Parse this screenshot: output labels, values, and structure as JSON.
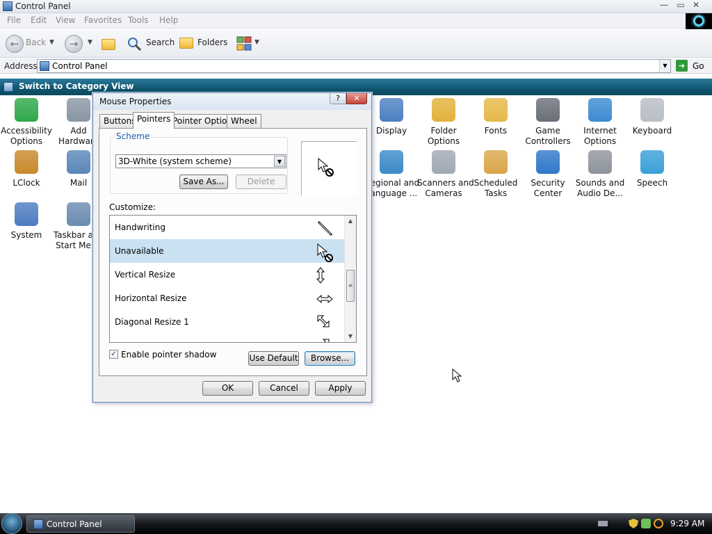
{
  "window": {
    "title": "Control Panel",
    "controls": {
      "minimize": "—",
      "maximize": "▭",
      "close": "✕"
    }
  },
  "menu": [
    "File",
    "Edit",
    "View",
    "Favorites",
    "Tools",
    "Help"
  ],
  "toolbar": {
    "back_label": "Back",
    "search_label": "Search",
    "folders_label": "Folders"
  },
  "address": {
    "label": "Address",
    "value": "Control Panel",
    "go_label": "Go"
  },
  "sidebar": {
    "task_label": "Switch to Category View"
  },
  "control_panel_items": [
    {
      "label": "Accessibility\nOptions",
      "icon": "accessibility-icon"
    },
    {
      "label": "Add\nHardware",
      "icon": "add-hardware-icon"
    },
    {
      "label": "Display",
      "icon": "display-icon"
    },
    {
      "label": "Folder\nOptions",
      "icon": "folder-options-icon"
    },
    {
      "label": "Fonts",
      "icon": "fonts-icon"
    },
    {
      "label": "Game\nControllers",
      "icon": "game-controllers-icon"
    },
    {
      "label": "Internet\nOptions",
      "icon": "internet-options-icon"
    },
    {
      "label": "Keyboard",
      "icon": "keyboard-icon"
    },
    {
      "label": "LClock",
      "icon": "lclock-icon"
    },
    {
      "label": "Mail",
      "icon": "mail-icon"
    },
    {
      "label": "Regional and\nLanguage ...",
      "icon": "regional-icon"
    },
    {
      "label": "Scanners and\nCameras",
      "icon": "scanners-icon"
    },
    {
      "label": "Scheduled\nTasks",
      "icon": "scheduled-tasks-icon"
    },
    {
      "label": "Security\nCenter",
      "icon": "security-center-icon"
    },
    {
      "label": "Sounds and\nAudio De...",
      "icon": "sounds-icon"
    },
    {
      "label": "Speech",
      "icon": "speech-icon"
    },
    {
      "label": "System",
      "icon": "system-icon"
    },
    {
      "label": "Taskbar and\nStart Menu",
      "icon": "taskbar-icon"
    }
  ],
  "dialog": {
    "title": "Mouse Properties",
    "help": "?",
    "close": "✕",
    "tabs": [
      "Buttons",
      "Pointers",
      "Pointer Options",
      "Wheel"
    ],
    "active_tab": "Pointers",
    "scheme": {
      "legend": "Scheme",
      "selected": "3D-White (system scheme)",
      "save_as": "Save As...",
      "delete": "Delete"
    },
    "customize_label": "Customize:",
    "cursors": [
      {
        "name": "Handwriting",
        "icon": "pen-cursor-icon",
        "selected": false
      },
      {
        "name": "Unavailable",
        "icon": "unavailable-cursor-icon",
        "selected": true
      },
      {
        "name": "Vertical Resize",
        "icon": "vertical-resize-icon",
        "selected": false
      },
      {
        "name": "Horizontal Resize",
        "icon": "horizontal-resize-icon",
        "selected": false
      },
      {
        "name": "Diagonal Resize 1",
        "icon": "diagonal-resize-1-icon",
        "selected": false
      }
    ],
    "enable_shadow_label": "Enable pointer shadow",
    "enable_shadow_checked": true,
    "use_default": "Use Default",
    "browse": "Browse...",
    "ok": "OK",
    "cancel": "Cancel",
    "apply": "Apply"
  },
  "taskbar": {
    "task_button": "Control Panel",
    "clock": "9:29 AM"
  },
  "colors": {
    "sidebar_header": "#0f556f",
    "selection": "#c9e1f1",
    "scheme_legend": "#1d5aab"
  }
}
